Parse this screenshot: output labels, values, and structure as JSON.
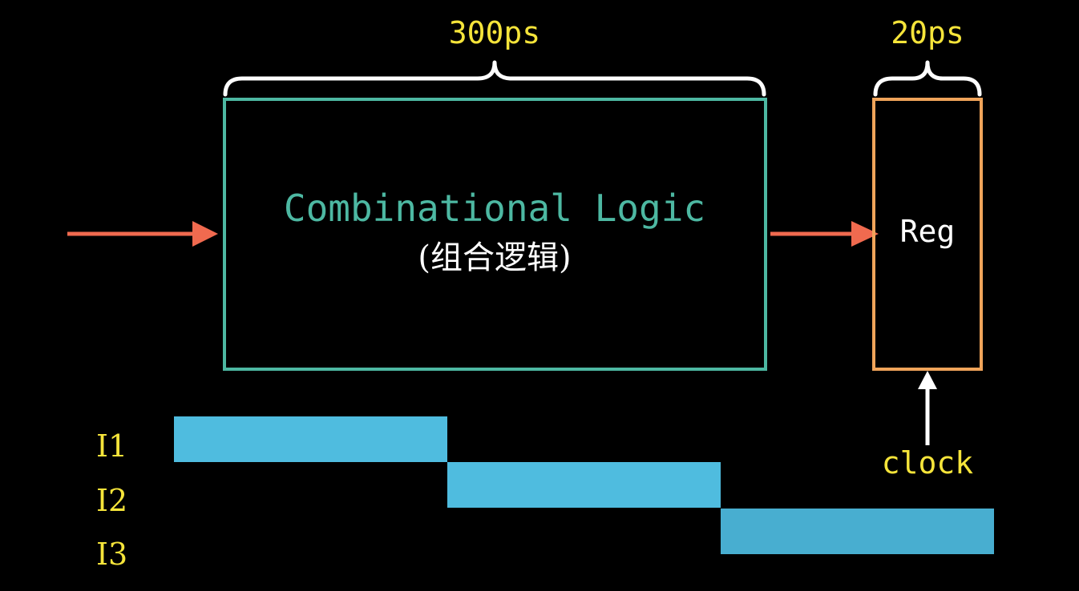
{
  "timing": {
    "logic_delay": "300ps",
    "reg_delay": "20ps"
  },
  "logic_block": {
    "title": "Combinational Logic",
    "subtitle": "(组合逻辑)"
  },
  "register": {
    "label": "Reg"
  },
  "clock": {
    "label": "clock"
  },
  "instructions": [
    "I1",
    "I2",
    "I3"
  ],
  "colors": {
    "background": "#000000",
    "label_yellow": "#f5e43a",
    "logic_teal": "#4db8a2",
    "reg_orange": "#f0a45a",
    "arrow_red": "#f06a4f",
    "bar_blue": "#4fbcdf",
    "bar_blue_last": "#48aed0",
    "white": "#ffffff"
  }
}
